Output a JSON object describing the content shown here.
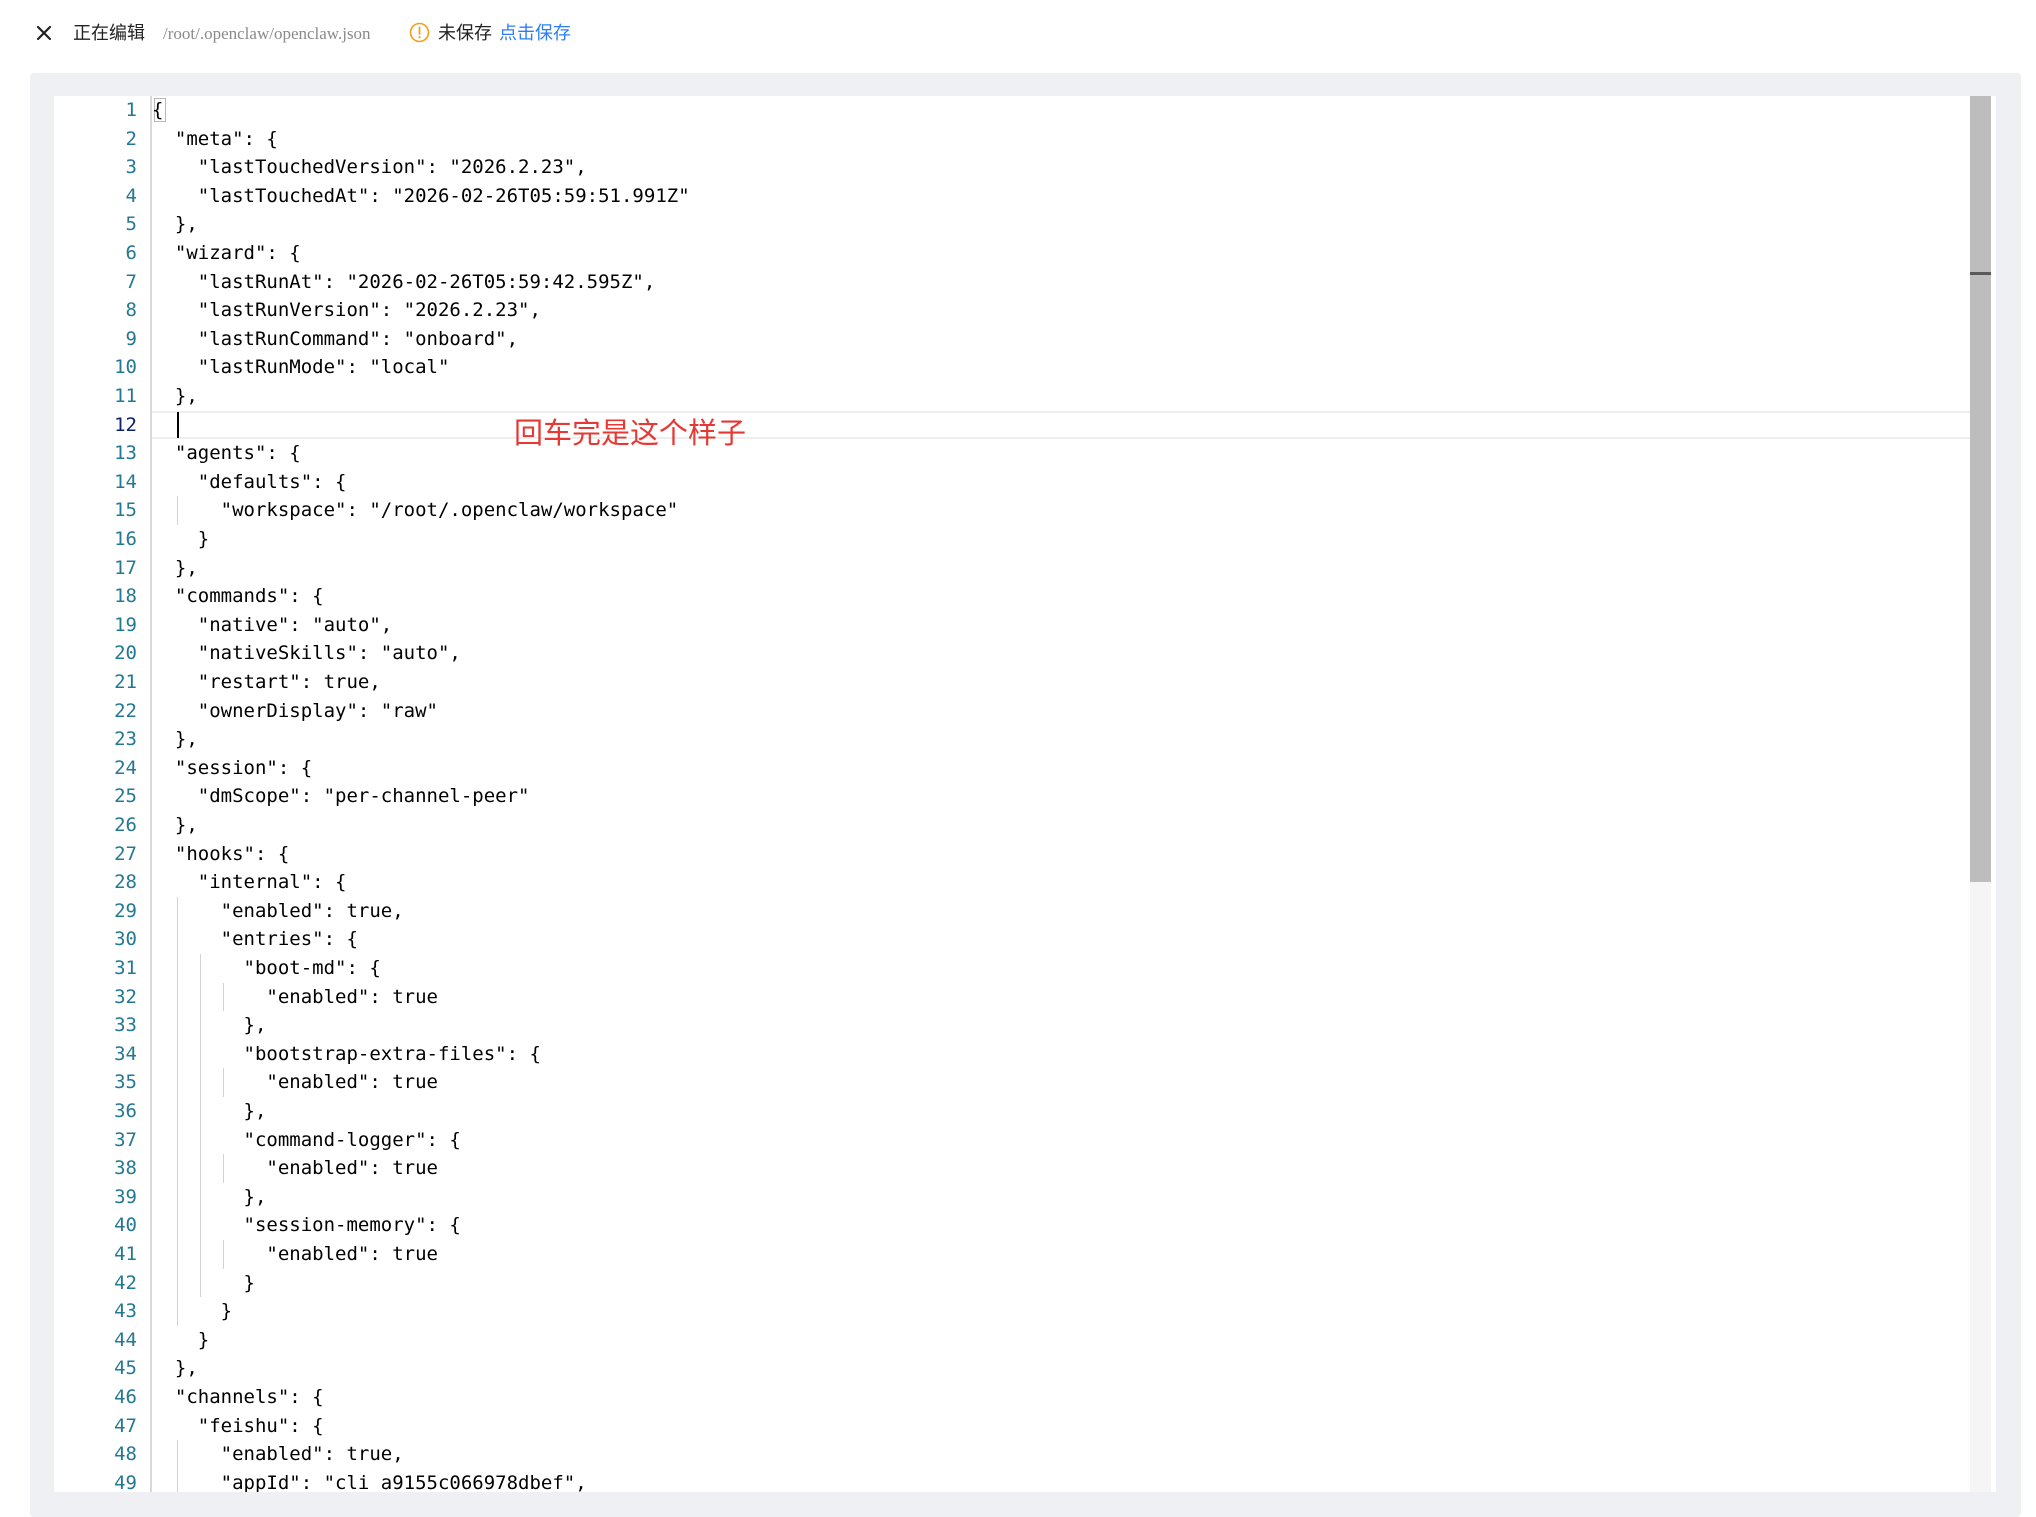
{
  "header": {
    "close_icon": "close-icon",
    "title": "正在编辑",
    "file_path": "/root/.openclaw/openclaw.json",
    "warning_icon": "warning-circle-icon",
    "status": "未保存",
    "save_label": "点击保存"
  },
  "annotation": "回车完是这个样子",
  "editor": {
    "active_line": 12,
    "lines": [
      "{",
      "  \"meta\": {",
      "    \"lastTouchedVersion\": \"2026.2.23\",",
      "    \"lastTouchedAt\": \"2026-02-26T05:59:51.991Z\"",
      "  },",
      "  \"wizard\": {",
      "    \"lastRunAt\": \"2026-02-26T05:59:42.595Z\",",
      "    \"lastRunVersion\": \"2026.2.23\",",
      "    \"lastRunCommand\": \"onboard\",",
      "    \"lastRunMode\": \"local\"",
      "  },",
      "",
      "  \"agents\": {",
      "    \"defaults\": {",
      "      \"workspace\": \"/root/.openclaw/workspace\"",
      "    }",
      "  },",
      "  \"commands\": {",
      "    \"native\": \"auto\",",
      "    \"nativeSkills\": \"auto\",",
      "    \"restart\": true,",
      "    \"ownerDisplay\": \"raw\"",
      "  },",
      "  \"session\": {",
      "    \"dmScope\": \"per-channel-peer\"",
      "  },",
      "  \"hooks\": {",
      "    \"internal\": {",
      "      \"enabled\": true,",
      "      \"entries\": {",
      "        \"boot-md\": {",
      "          \"enabled\": true",
      "        },",
      "        \"bootstrap-extra-files\": {",
      "          \"enabled\": true",
      "        },",
      "        \"command-logger\": {",
      "          \"enabled\": true",
      "        },",
      "        \"session-memory\": {",
      "          \"enabled\": true",
      "        }",
      "      }",
      "    }",
      "  },",
      "  \"channels\": {",
      "    \"feishu\": {",
      "      \"enabled\": true,",
      "      \"appId\": \"cli_a9155c066978dbef\","
    ]
  }
}
